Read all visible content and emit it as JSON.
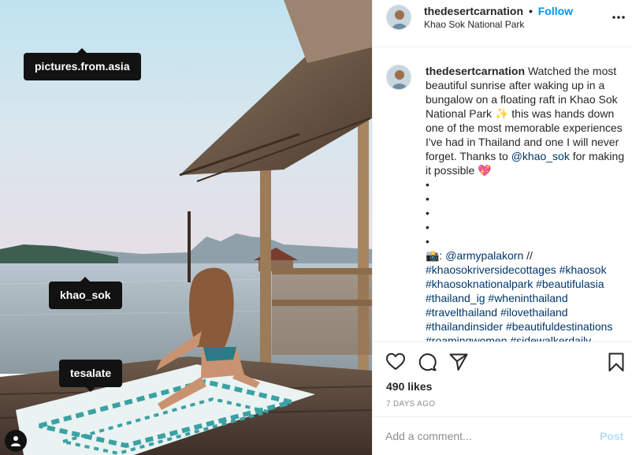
{
  "photo": {
    "tags": [
      {
        "label": "pictures.from.asia"
      },
      {
        "label": "khao_sok"
      },
      {
        "label": "tesalate"
      }
    ]
  },
  "header": {
    "username": "thedesertcarnation",
    "separator": "•",
    "follow_label": "Follow",
    "location": "Khao Sok National Park"
  },
  "caption": {
    "username": "thedesertcarnation",
    "text_part1": "Watched the most beautiful sunrise after waking up in a bungalow on a floating raft in Khao Sok National Park",
    "sparkle": "✨",
    "text_part2": "this was hands down one of the most memorable experiences I've had in Thailand and one I will never forget. Thanks to",
    "mention": "@khao_sok",
    "text_part3": "for making it possible",
    "heart": "💖",
    "bullets": [
      "•",
      "•",
      "•",
      "•",
      "•"
    ],
    "camera": "📸",
    "credit_colon": ":",
    "credit_mention": "@armypalakorn",
    "credit_sep": "//",
    "hashtags": [
      "#khaosokriversidecottages",
      "#khaosok",
      "#khaosoknationalpark",
      "#beautifulasia",
      "#thailand_ig",
      "#wheninthailand",
      "#travelthailand",
      "#ilovethailand",
      "#thailandinsider",
      "#beautifuldestinations",
      "#roamingwomen",
      "#sidewalkerdaily"
    ]
  },
  "actions": {
    "likes": "490 likes",
    "timestamp": "7 DAYS AGO"
  },
  "comment": {
    "placeholder": "Add a comment...",
    "post_label": "Post"
  },
  "colors": {
    "accent": "#0095f6",
    "link": "#00376b",
    "post_disabled": "#b2dffc",
    "muted": "#8e8e8e"
  }
}
